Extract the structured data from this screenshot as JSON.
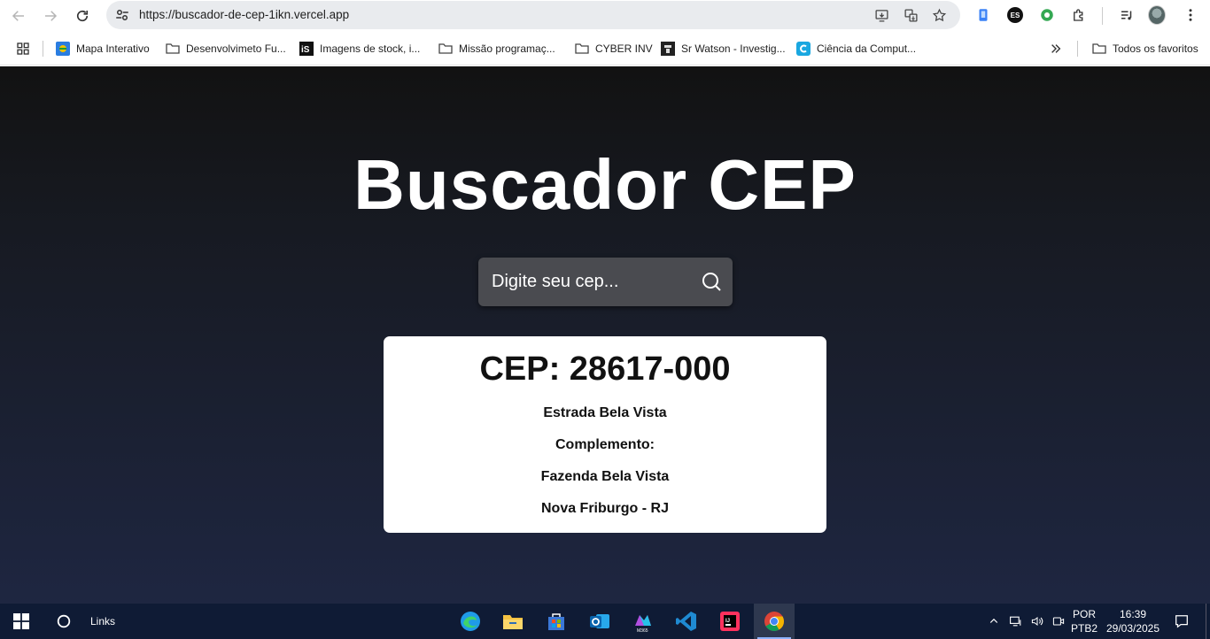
{
  "browser": {
    "url": "https://buscador-de-cep-1ikn.vercel.app",
    "extensions": {
      "es_badge": "ES"
    },
    "bookmarks": [
      {
        "label": "Mapa Interativo",
        "icon": "map-favicon-icon"
      },
      {
        "label": "Desenvolvimeto Fu...",
        "icon": "folder-icon"
      },
      {
        "label": "Imagens de stock, i...",
        "icon": "istock-favicon-icon"
      },
      {
        "label": "Missão programaç...",
        "icon": "folder-icon"
      },
      {
        "label": "CYBER INV",
        "icon": "folder-icon"
      },
      {
        "label": "Sr Watson - Investig...",
        "icon": "watson-favicon-icon"
      },
      {
        "label": "Ciência da Comput...",
        "icon": "c-favicon-icon"
      }
    ],
    "all_bookmarks_label": "Todos os favoritos"
  },
  "page": {
    "title": "Buscador CEP",
    "search": {
      "placeholder": "Digite seu cep..."
    },
    "result": {
      "cep": "CEP: 28617-000",
      "street": "Estrada Bela Vista",
      "complement": "Complemento:",
      "neighborhood": "Fazenda Bela Vista",
      "city_state": "Nova Friburgo - RJ"
    }
  },
  "taskbar": {
    "search_label": "Links",
    "language": "POR",
    "layout": "PTB2",
    "time": "16:39",
    "date": "29/03/2025",
    "apps": [
      "edge-icon",
      "file-explorer-icon",
      "store-icon",
      "outlook-icon",
      "m365-icon",
      "vscode-icon",
      "intellij-icon",
      "chrome-icon"
    ]
  },
  "colors": {
    "page_bg_top": "#121212",
    "page_bg_bottom": "#1e2641",
    "search_bg": "#4a4b50",
    "card_bg": "#ffffff",
    "taskbar_bg": "#0f1b35"
  }
}
